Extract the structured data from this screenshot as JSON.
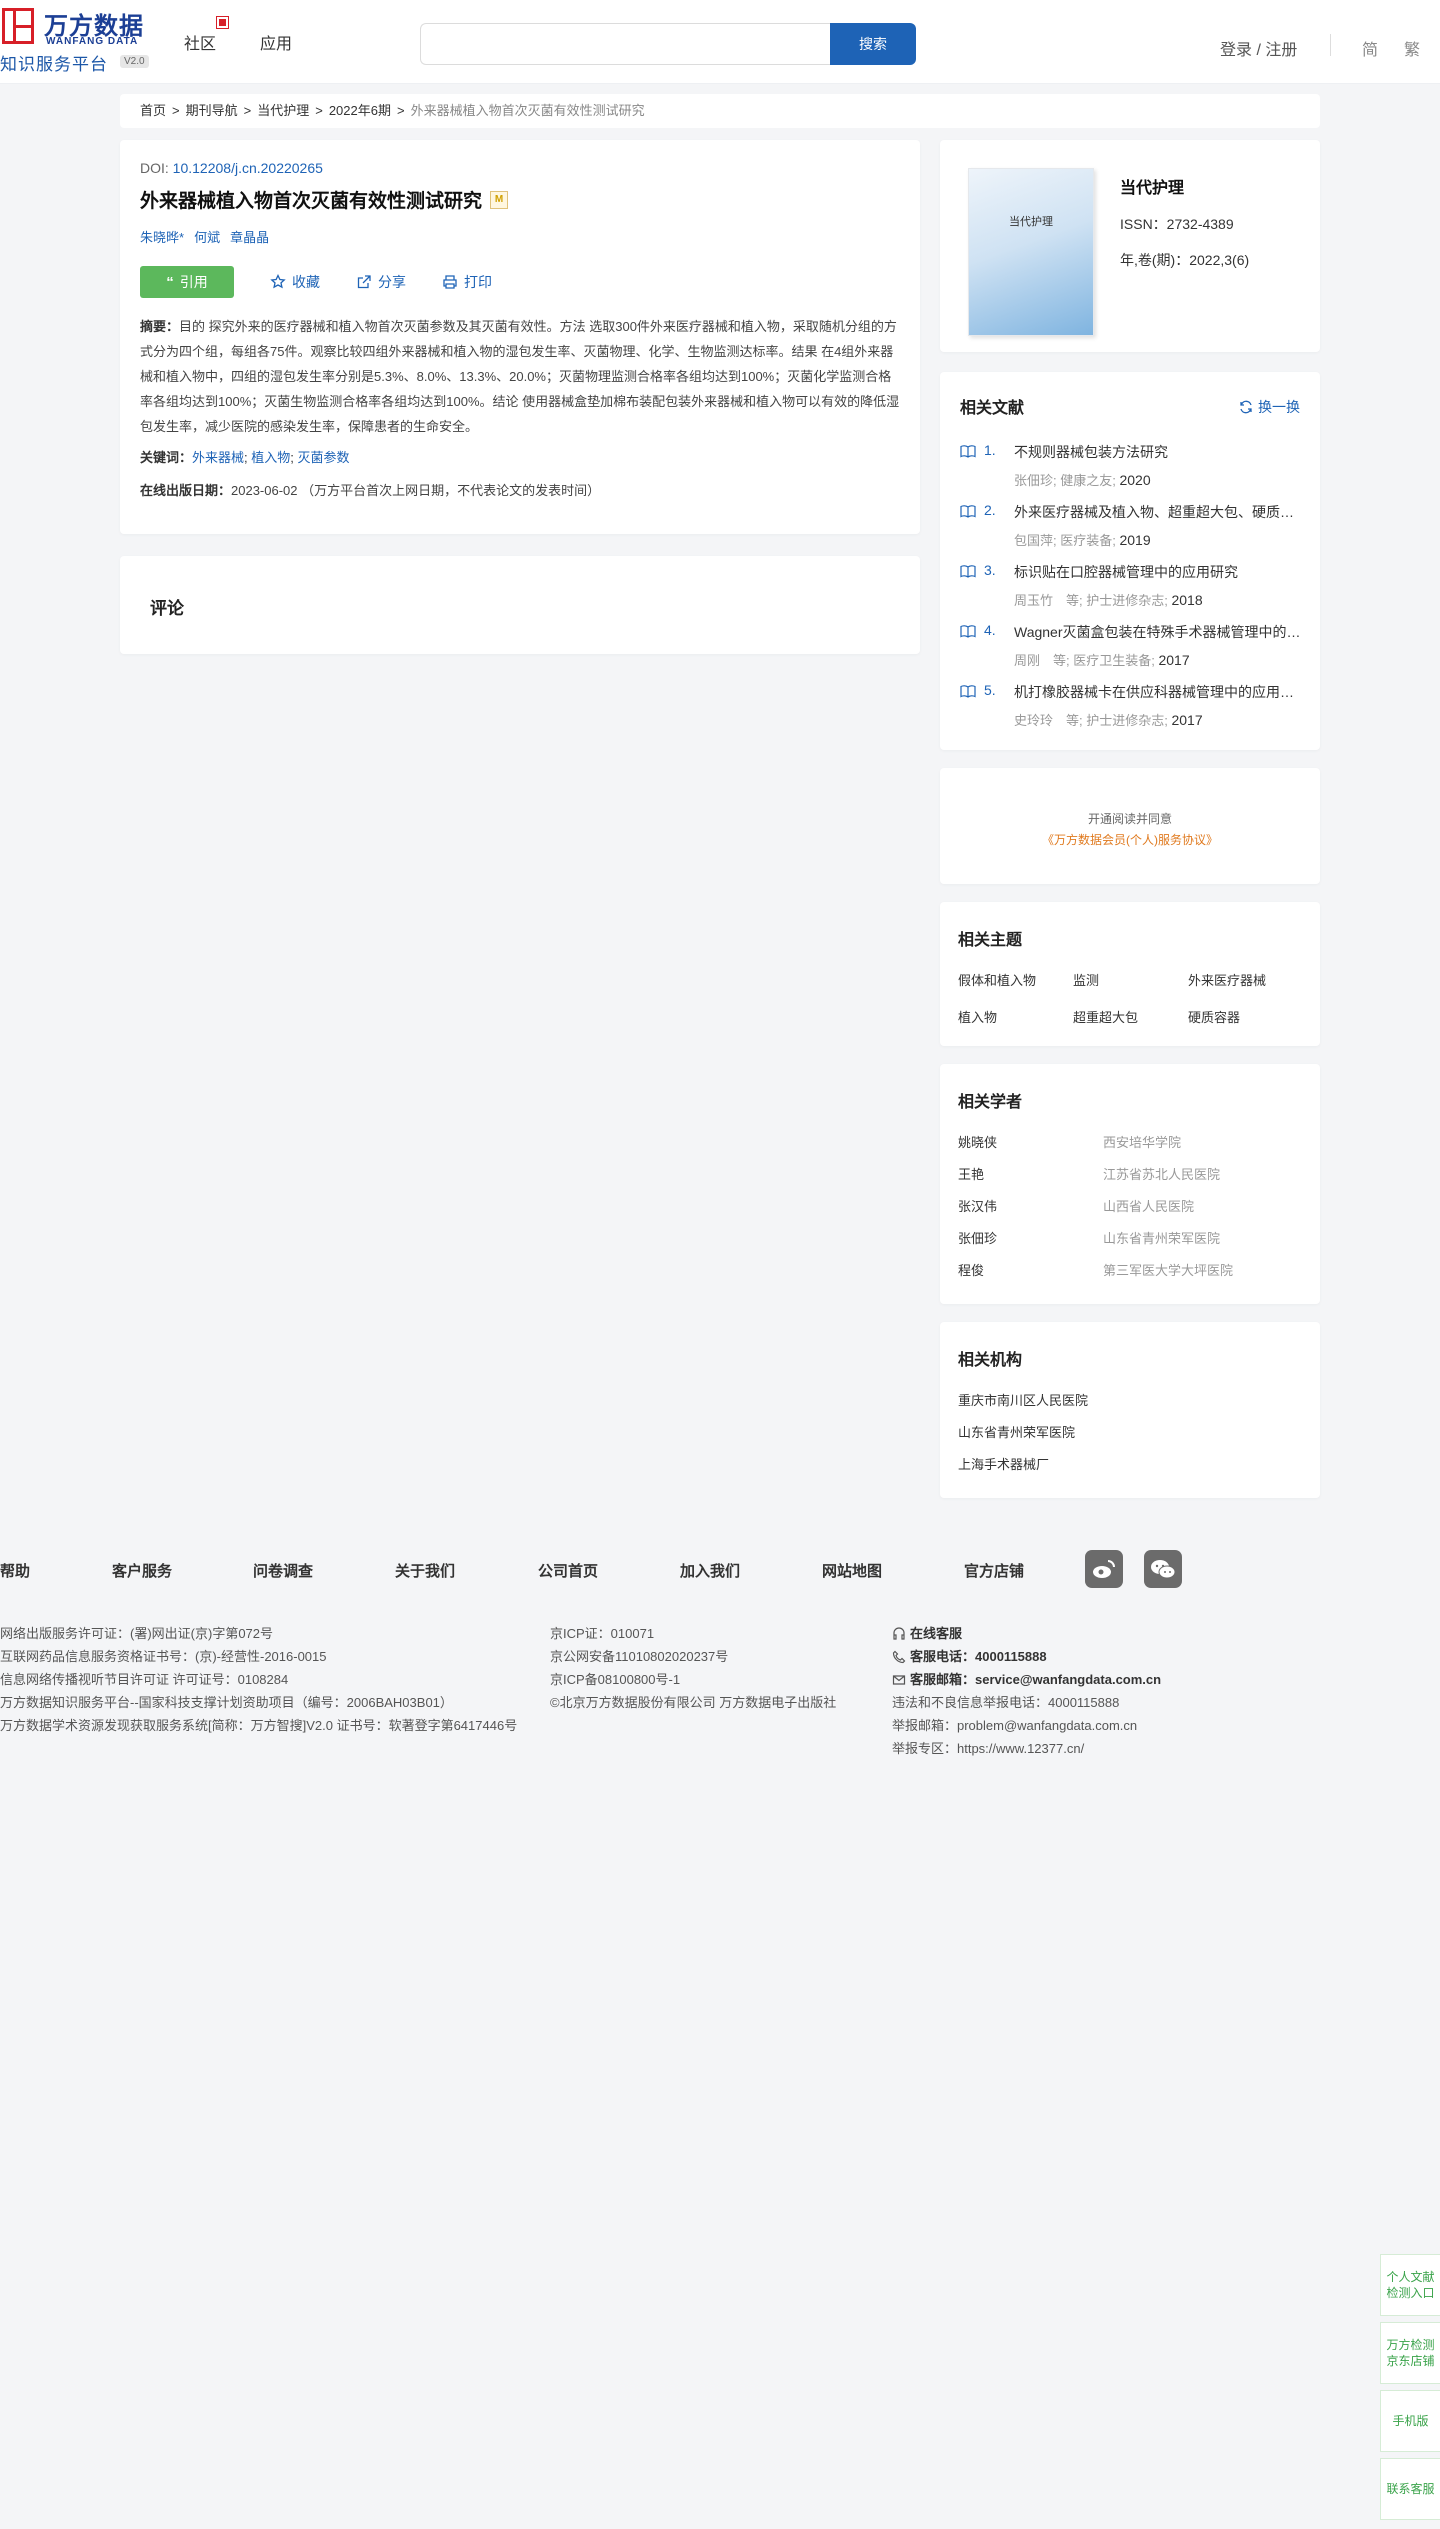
{
  "header": {
    "logo_cn": "万方数据",
    "logo_en": "WANFANG DATA",
    "logo_sub": "知识服务平台",
    "logo_ver": "V2.0",
    "nav": [
      "社区",
      "应用"
    ],
    "search_placeholder": "",
    "search_button": "搜索",
    "login": "登录 / 注册",
    "lang_simplified": "简",
    "lang_traditional": "繁"
  },
  "breadcrumb": {
    "items": [
      "首页",
      "期刊导航",
      "当代护理",
      "2022年6期"
    ],
    "current": "外来器械植入物首次灭菌有效性测试研究"
  },
  "article": {
    "doi_label": "DOI: ",
    "doi": "10.12208/j.cn.20220265",
    "title": "外来器械植入物首次灭菌有效性测试研究",
    "title_badge": "M",
    "authors": [
      "朱晓晔*",
      "何斌",
      "章晶晶"
    ],
    "actions": {
      "cite": "引用",
      "favorite": "收藏",
      "share": "分享",
      "print": "打印"
    },
    "abstract_label": "摘要：",
    "abstract": "目的 探究外来的医疗器械和植入物首次灭菌参数及其灭菌有效性。方法 选取300件外来医疗器械和植入物，采取随机分组的方式分为四个组，每组各75件。观察比较四组外来器械和植入物的湿包发生率、灭菌物理、化学、生物监测达标率。结果 在4组外来器械和植入物中，四组的湿包发生率分别是5.3%、8.0%、13.3%、20.0%；灭菌物理监测合格率各组均达到100%；灭菌化学监测合格率各组均达到100%；灭菌生物监测合格率各组均达到100%。结论 使用器械盒垫加棉布装配包装外来器械和植入物可以有效的降低湿包发生率，减少医院的感染发生率，保障患者的生命安全。",
    "keywords_label": "关键词：",
    "keywords": [
      "外来器械",
      "植入物",
      "灭菌参数"
    ],
    "pubdate_label": "在线出版日期：",
    "pubdate": "2023-06-02 （万方平台首次上网日期，不代表论文的发表时间）"
  },
  "comments": {
    "title": "评论"
  },
  "journal": {
    "cover_title": "当代护理",
    "name": "当代护理",
    "issn": "ISSN：2732-4389",
    "volume": "年,卷(期)：2022,3(6)"
  },
  "related_docs": {
    "title": "相关文献",
    "refresh": "换一换",
    "items": [
      {
        "num": "1.",
        "title": "不规则器械包装方法研究",
        "meta": "张佃珍; 健康之友;",
        "year": "2020"
      },
      {
        "num": "2.",
        "title": "外来医疗器械及植入物、超重超大包、硬质容器灭菌",
        "meta": "包国萍; 医疗装备;",
        "year": "2019"
      },
      {
        "num": "3.",
        "title": "标识贴在口腔器械管理中的应用研究",
        "meta": "周玉竹　等; 护士进修杂志;",
        "year": "2018"
      },
      {
        "num": "4.",
        "title": "Wagner灭菌盒包装在特殊手术器械管理中的应用",
        "meta": "周刚　等; 医疗卫生装备;",
        "year": "2017"
      },
      {
        "num": "5.",
        "title": "机打橡胶器械卡在供应科器械管理中的应用研究",
        "meta": "史玲玲　等; 护士进修杂志;",
        "year": "2017"
      }
    ]
  },
  "promo": {
    "line1": "开通阅读并同意",
    "line2": "《万方数据会员(个人)服务协议》"
  },
  "topics": {
    "title": "相关主题",
    "items": [
      "假体和植入物",
      "监测",
      "外来医疗器械",
      "植入物",
      "超重超大包",
      "硬质容器"
    ]
  },
  "scholars": {
    "title": "相关学者",
    "items": [
      {
        "name": "姚晓侠",
        "org": "西安培华学院"
      },
      {
        "name": "王艳",
        "org": "江苏省苏北人民医院"
      },
      {
        "name": "张汉伟",
        "org": "山西省人民医院"
      },
      {
        "name": "张佃珍",
        "org": "山东省青州荣军医院"
      },
      {
        "name": "程俊",
        "org": "第三军医大学大坪医院"
      }
    ]
  },
  "orgs": {
    "title": "相关机构",
    "items": [
      "重庆市南川区人民医院",
      "山东省青州荣军医院",
      "上海手术器械厂"
    ]
  },
  "footer": {
    "nav": [
      "帮助",
      "客户服务",
      "问卷调查",
      "关于我们",
      "公司首页",
      "加入我们",
      "网站地图",
      "官方店铺"
    ],
    "col1": [
      "网络出版服务许可证：(署)网出证(京)字第072号",
      "互联网药品信息服务资格证书号：(京)-经营性-2016-0015",
      "信息网络传播视听节目许可证 许可证号：0108284",
      "万方数据知识服务平台--国家科技支撑计划资助项目（编号：2006BAH03B01）",
      "万方数据学术资源发现获取服务系统[简称：万方智搜]V2.0 证书号：软著登字第6417446号"
    ],
    "col2": [
      "京ICP证：010071",
      "京公网安备11010802020237号",
      "京ICP备08100800号-1",
      "©北京万方数据股份有限公司 万方数据电子出版社"
    ],
    "online_service": "在线客服",
    "phone_label": "客服电话：",
    "phone": "4000115888",
    "email_label": "客服邮箱：",
    "email": "service@wanfangdata.com.cn",
    "report_phone": "违法和不良信息举报电话：4000115888",
    "report_email": "举报邮箱：problem@wanfangdata.com.cn",
    "report_site": "举报专区：https://www.12377.cn/"
  },
  "float_bar": [
    "个人文献检测入口",
    "万方检测京东店铺",
    "手机版",
    "联系客服"
  ],
  "colors": {
    "brand_blue": "#1e63b6",
    "cite_green": "#5cb85c",
    "logo_red": "#d71f28",
    "promo_orange": "#e07a1f"
  }
}
